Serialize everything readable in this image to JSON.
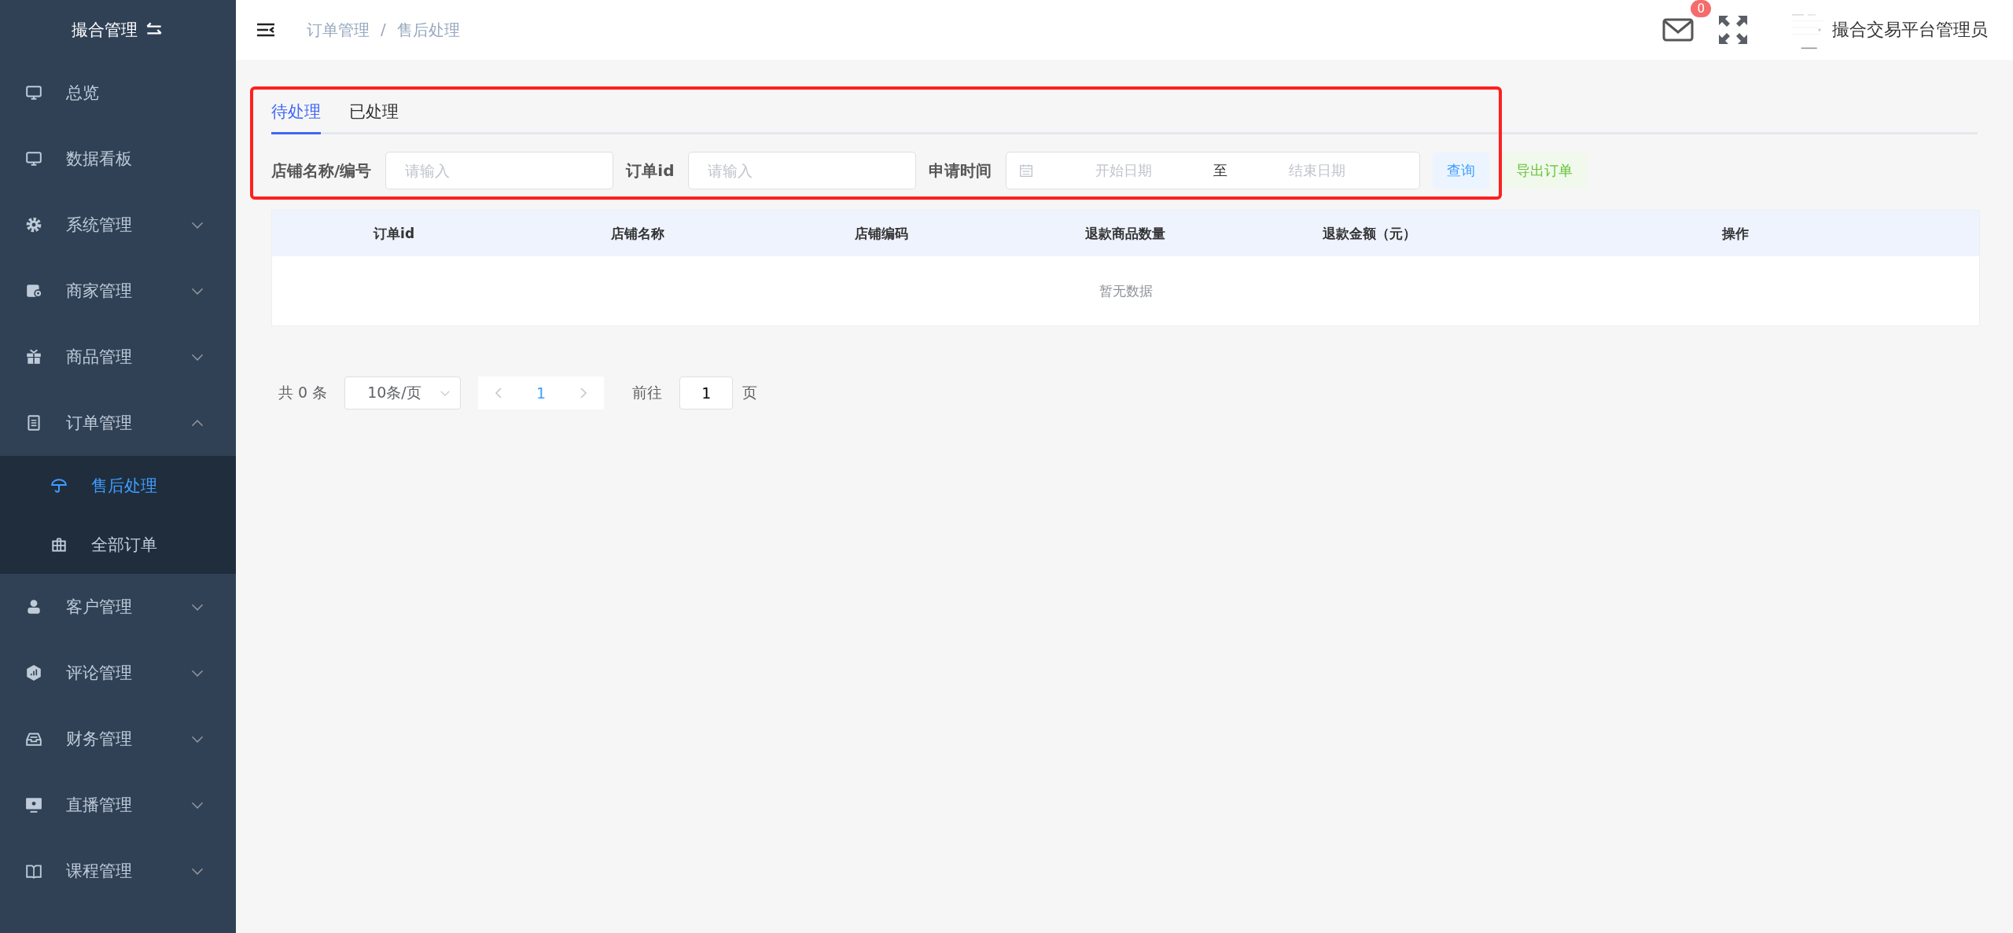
{
  "sidebar": {
    "title": "撮合管理",
    "items": [
      {
        "label": "总览",
        "expandable": false
      },
      {
        "label": "数据看板",
        "expandable": false
      },
      {
        "label": "系统管理",
        "expandable": true,
        "expanded": false
      },
      {
        "label": "商家管理",
        "expandable": true,
        "expanded": false
      },
      {
        "label": "商品管理",
        "expandable": true,
        "expanded": false
      },
      {
        "label": "订单管理",
        "expandable": true,
        "expanded": true,
        "children": [
          {
            "label": "售后处理",
            "selected": true
          },
          {
            "label": "全部订单",
            "selected": false
          }
        ]
      },
      {
        "label": "客户管理",
        "expandable": true,
        "expanded": false
      },
      {
        "label": "评论管理",
        "expandable": true,
        "expanded": false
      },
      {
        "label": "财务管理",
        "expandable": true,
        "expanded": false
      },
      {
        "label": "直播管理",
        "expandable": true,
        "expanded": false
      },
      {
        "label": "课程管理",
        "expandable": true,
        "expanded": false
      }
    ]
  },
  "header": {
    "breadcrumb": [
      "订单管理",
      "售后处理"
    ],
    "breadcrumb_separator": "/",
    "message_count": "0",
    "user_name": "撮合交易平台管理员"
  },
  "tabs": [
    {
      "label": "待处理",
      "selected": true
    },
    {
      "label": "已处理",
      "selected": false
    }
  ],
  "filters": [
    {
      "kind": "text",
      "label": "店铺名称/编号",
      "placeholder": "请输入"
    },
    {
      "kind": "text",
      "label": "订单id",
      "placeholder": "请输入"
    },
    {
      "kind": "daterange",
      "label": "申请时间",
      "start_placeholder": "开始日期",
      "separator": "至",
      "end_placeholder": "结束日期"
    }
  ],
  "buttons": [
    {
      "kind": "primary",
      "label": "查询"
    },
    {
      "kind": "success",
      "label": "导出订单"
    }
  ],
  "table": {
    "columns": [
      "订单id",
      "店铺名称",
      "店铺编码",
      "退款商品数量",
      "退款金额（元）",
      "操作"
    ],
    "empty_text": "暂无数据"
  },
  "pagination": {
    "total": "共 0 条",
    "page_size": "10条/页",
    "current_page": "1",
    "goto_label": "前往",
    "goto_value": "1",
    "page_suffix": "页"
  }
}
